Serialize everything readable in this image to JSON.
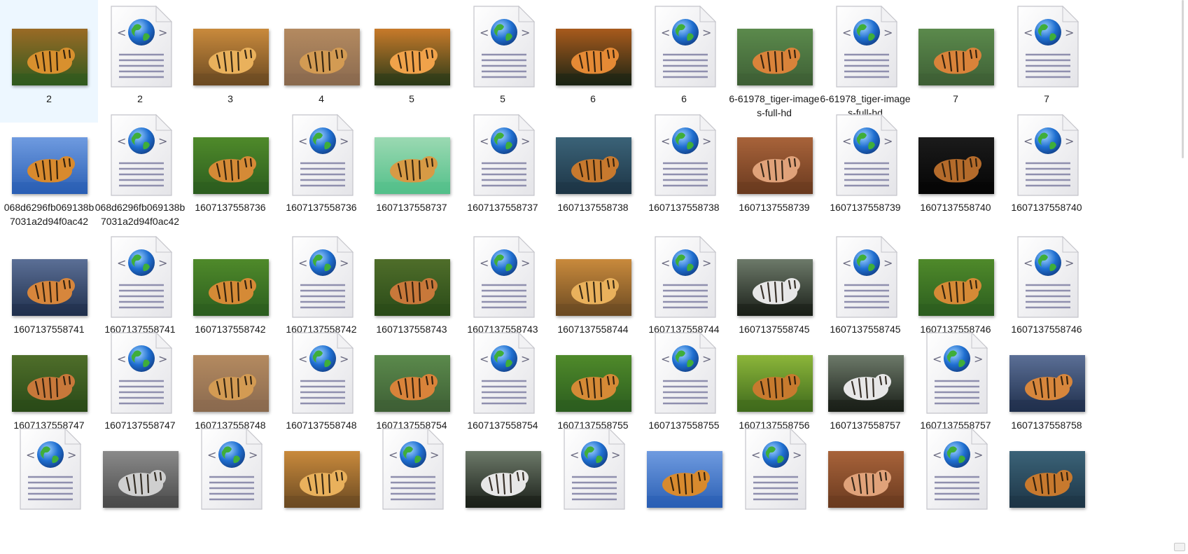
{
  "colors": {
    "background": "#ffffff",
    "label_text": "#1a1a1a",
    "doc_lines": "#8f8fae",
    "globe_blue": "#1f6fd1",
    "globe_green": "#3fae3a"
  },
  "rows": [
    [
      {
        "name": "2",
        "icon": "photo",
        "tone": "jungle"
      },
      {
        "name": "2",
        "icon": "html-document-icon"
      },
      {
        "name": "3",
        "icon": "photo",
        "tone": "golden"
      },
      {
        "name": "4",
        "icon": "photo",
        "tone": "rocky"
      },
      {
        "name": "5",
        "icon": "photo",
        "tone": "face"
      },
      {
        "name": "5",
        "icon": "html-document-icon"
      },
      {
        "name": "6",
        "icon": "photo",
        "tone": "roar"
      },
      {
        "name": "6",
        "icon": "html-document-icon"
      },
      {
        "name": "6-61978_tiger-images-full-hd",
        "icon": "photo",
        "tone": "water"
      },
      {
        "name": "6-61978_tiger-images-full-hd",
        "icon": "html-document-icon"
      },
      {
        "name": "7",
        "icon": "photo",
        "tone": "water"
      },
      {
        "name": "7",
        "icon": "html-document-icon"
      }
    ],
    [
      {
        "name": "068d6296fb069138b7031a2d94f0ac42",
        "icon": "photo",
        "tone": "sky"
      },
      {
        "name": "068d6296fb069138b7031a2d94f0ac42",
        "icon": "html-document-icon"
      },
      {
        "name": "1607137558736",
        "icon": "photo",
        "tone": "grass"
      },
      {
        "name": "1607137558736",
        "icon": "html-document-icon"
      },
      {
        "name": "1607137558737",
        "icon": "photo",
        "tone": "mint"
      },
      {
        "name": "1607137558737",
        "icon": "html-document-icon"
      },
      {
        "name": "1607137558738",
        "icon": "photo",
        "tone": "river"
      },
      {
        "name": "1607137558738",
        "icon": "html-document-icon"
      },
      {
        "name": "1607137558739",
        "icon": "photo",
        "tone": "warm"
      },
      {
        "name": "1607137558739",
        "icon": "html-document-icon"
      },
      {
        "name": "1607137558740",
        "icon": "photo",
        "tone": "dark"
      },
      {
        "name": "1607137558740",
        "icon": "html-document-icon"
      }
    ],
    [
      {
        "name": "1607137558741",
        "icon": "photo",
        "tone": "blue"
      },
      {
        "name": "1607137558741",
        "icon": "html-document-icon"
      },
      {
        "name": "1607137558742",
        "icon": "photo",
        "tone": "grass"
      },
      {
        "name": "1607137558742",
        "icon": "html-document-icon"
      },
      {
        "name": "1607137558743",
        "icon": "photo",
        "tone": "moss"
      },
      {
        "name": "1607137558743",
        "icon": "html-document-icon"
      },
      {
        "name": "1607137558744",
        "icon": "photo",
        "tone": "golden"
      },
      {
        "name": "1607137558744",
        "icon": "html-document-icon"
      },
      {
        "name": "1607137558745",
        "icon": "photo",
        "tone": "white"
      },
      {
        "name": "1607137558745",
        "icon": "html-document-icon"
      },
      {
        "name": "1607137558746",
        "icon": "photo",
        "tone": "grass"
      },
      {
        "name": "1607137558746",
        "icon": "html-document-icon"
      }
    ],
    [
      {
        "name": "1607137558747",
        "icon": "photo",
        "tone": "moss"
      },
      {
        "name": "1607137558747",
        "icon": "html-document-icon"
      },
      {
        "name": "1607137558748",
        "icon": "photo",
        "tone": "rocky"
      },
      {
        "name": "1607137558748",
        "icon": "html-document-icon"
      },
      {
        "name": "1607137558754",
        "icon": "photo",
        "tone": "water"
      },
      {
        "name": "1607137558754",
        "icon": "html-document-icon"
      },
      {
        "name": "1607137558755",
        "icon": "photo",
        "tone": "grass"
      },
      {
        "name": "1607137558755",
        "icon": "html-document-icon"
      },
      {
        "name": "1607137558756",
        "icon": "photo",
        "tone": "leaves"
      },
      {
        "name": "1607137558757",
        "icon": "photo",
        "tone": "white"
      },
      {
        "name": "1607137558757",
        "icon": "html-document-icon"
      },
      {
        "name": "1607137558758",
        "icon": "photo",
        "tone": "blue"
      }
    ],
    [
      {
        "name": "",
        "icon": "html-document-icon"
      },
      {
        "name": "",
        "icon": "photo",
        "tone": "gray"
      },
      {
        "name": "",
        "icon": "html-document-icon"
      },
      {
        "name": "",
        "icon": "photo",
        "tone": "golden"
      },
      {
        "name": "",
        "icon": "html-document-icon"
      },
      {
        "name": "",
        "icon": "photo",
        "tone": "white"
      },
      {
        "name": "",
        "icon": "html-document-icon"
      },
      {
        "name": "",
        "icon": "photo",
        "tone": "sky"
      },
      {
        "name": "",
        "icon": "html-document-icon"
      },
      {
        "name": "",
        "icon": "photo",
        "tone": "warm"
      },
      {
        "name": "",
        "icon": "html-document-icon"
      },
      {
        "name": "",
        "icon": "photo",
        "tone": "river"
      }
    ]
  ]
}
